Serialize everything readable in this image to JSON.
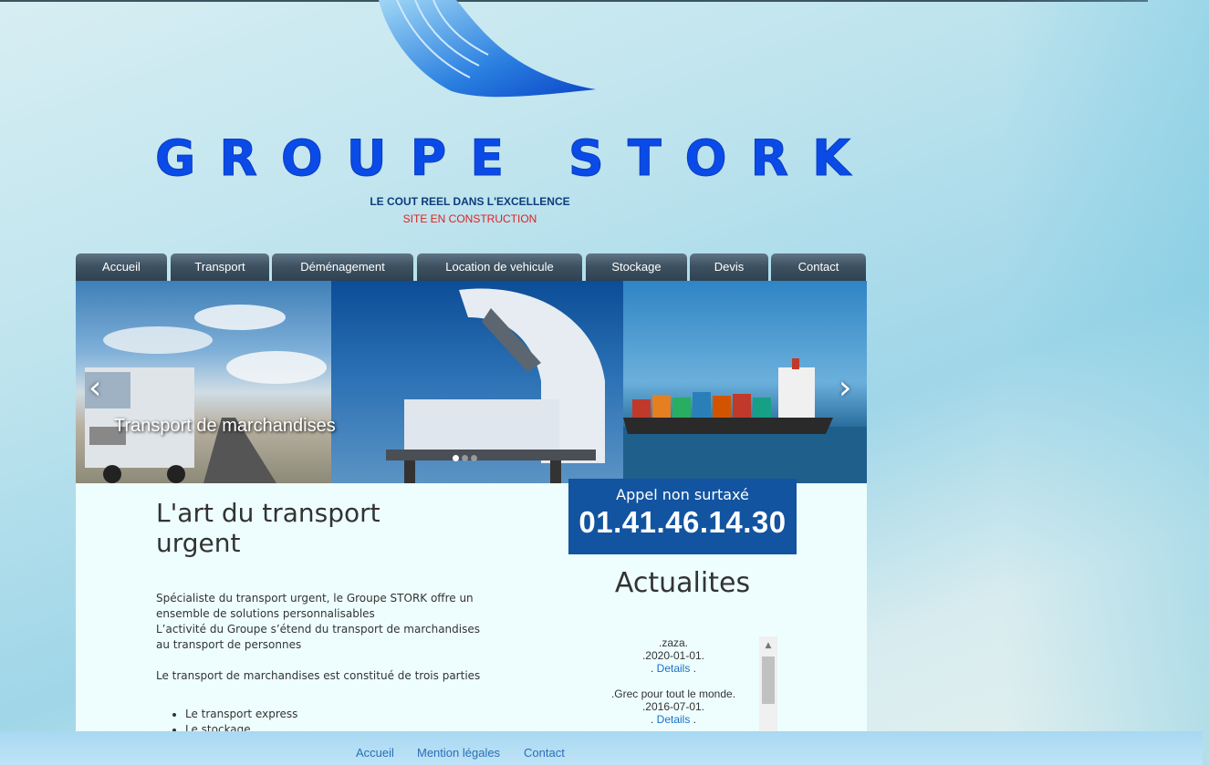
{
  "brand": {
    "name": "Groupe Stork",
    "tagline": "LE COUT REEL DANS L'EXCELLENCE",
    "notice": "SITE EN CONSTRUCTION"
  },
  "nav": {
    "items": [
      "Accueil",
      "Transport",
      "Déménagement",
      "Location de vehicule",
      "Stockage",
      "Devis",
      "Contact"
    ]
  },
  "slider": {
    "caption": "Transport de marchandises",
    "prev_glyph": "‹",
    "next_glyph": "›",
    "slides": 3,
    "active_index": 0
  },
  "main": {
    "title": "L'art du transport urgent",
    "paragraphs": [
      "Spécialiste du transport urgent, le Groupe STORK offre un ensemble de solutions personnalisables",
      "L’activité du Groupe s’étend du transport de marchandises au transport de personnes",
      "Le transport de marchandises est constitué de trois parties"
    ],
    "list": [
      "Le transport express",
      "Le stockage"
    ]
  },
  "call": {
    "label": "Appel non surtaxé",
    "number": "01.41.46.14.30"
  },
  "news": {
    "title": "Actualites",
    "items": [
      {
        "title": ".zaza.",
        "date": ".2020-01-01.",
        "link": "Details"
      },
      {
        "title": ".Grec pour tout le monde.",
        "date": ".2016-07-01.",
        "link": "Details"
      }
    ]
  },
  "footer": {
    "links": [
      "Accueil",
      "Mention légales",
      "Contact"
    ]
  },
  "colors": {
    "brand_blue": "#0a4be8",
    "nav_dark": "#3e5262",
    "call_bg": "#1254a0",
    "notice_red": "#e02020",
    "link_blue": "#1a6fc9"
  }
}
